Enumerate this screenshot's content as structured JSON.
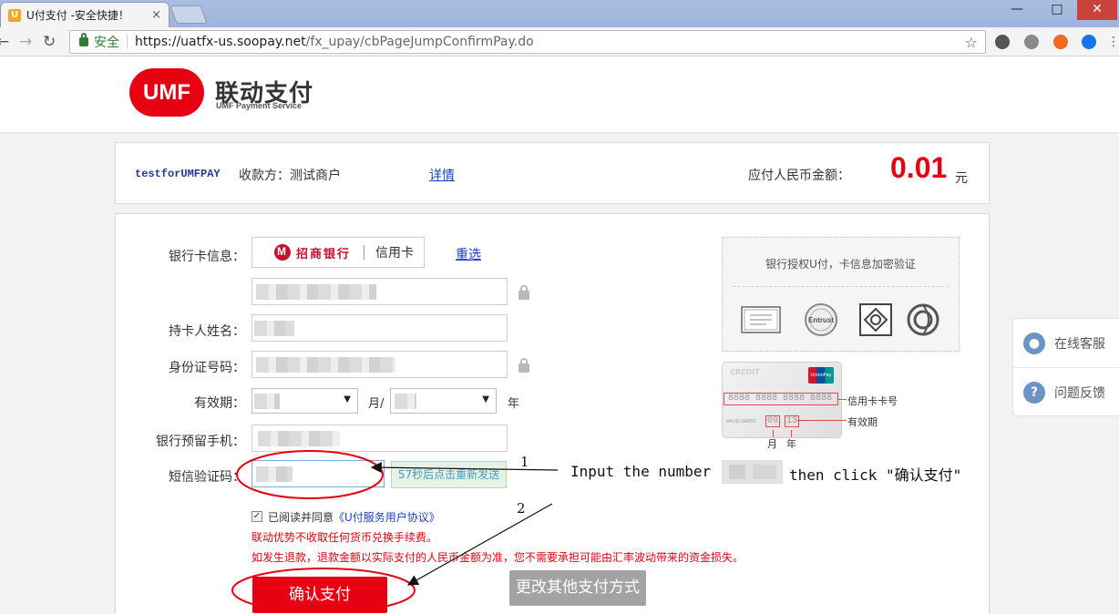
{
  "browser": {
    "tab_title": "U付支付 -安全快捷！",
    "tab_close": "×",
    "favicon": "U",
    "secure_label": "安全",
    "url_host": "https://uatfx-us.soopay.net",
    "url_path": "/fx_upay/cbPageJumpConfirmPay.do",
    "win_min": "—",
    "win_max": "□",
    "win_close": "✕",
    "back": "←",
    "forward": "→",
    "reload": "↻",
    "star": "☆"
  },
  "header": {
    "logo_mark": "UMF",
    "logo_cn": "联动支付",
    "logo_en": "UMF Payment Service"
  },
  "order": {
    "merchant_id": "testforUMFPAY",
    "payee": "收款方：测试商户",
    "detail_link": "详情",
    "amount_label": "应付人民币金额：",
    "amount": "0.01",
    "currency": "元"
  },
  "form": {
    "bank_card_label": "银行卡信息：",
    "bank_name": "招商银行",
    "card_type": "信用卡",
    "reselect": "重选",
    "holder_label": "持卡人姓名：",
    "id_label": "身份证号码：",
    "expiry_label": "有效期：",
    "month_unit": "月/",
    "year_unit": "年",
    "phone_label": "银行预留手机：",
    "sms_label": "短信验证码：",
    "sms_button": "57秒后点击重新发送",
    "agree_prefix": "已阅读并同意",
    "agree_link": "《U付服务用户协议》",
    "checkbox_mark": "✓",
    "notice1": "联动优势不收取任何货币兑换手续费。",
    "notice2": "如发生退款，退款金额以实际支付的人民币金额为准，您不需要承担可能由汇率波动带来的资金损失。",
    "confirm_button": "确认支付",
    "other_button": "更改其他支付方式"
  },
  "auth": {
    "title": "银行授权U付，卡信息加密验证"
  },
  "card_sample": {
    "number": "8888 8888 8888 8888",
    "valid_label": "VALID DATES",
    "month": "09",
    "year": "13",
    "number_note": "信用卡卡号",
    "expiry_note": "有效期",
    "month_note": "月",
    "year_note": "年"
  },
  "annotation": {
    "step1": "1",
    "step2": "2",
    "text_before": "Input the number",
    "text_after": "then click \"确认支付\""
  },
  "side_widget": {
    "online_service": "在线客服",
    "feedback": "问题反馈"
  },
  "colors": {
    "brand_red": "#e60012",
    "link_blue": "#1a3ec5"
  }
}
